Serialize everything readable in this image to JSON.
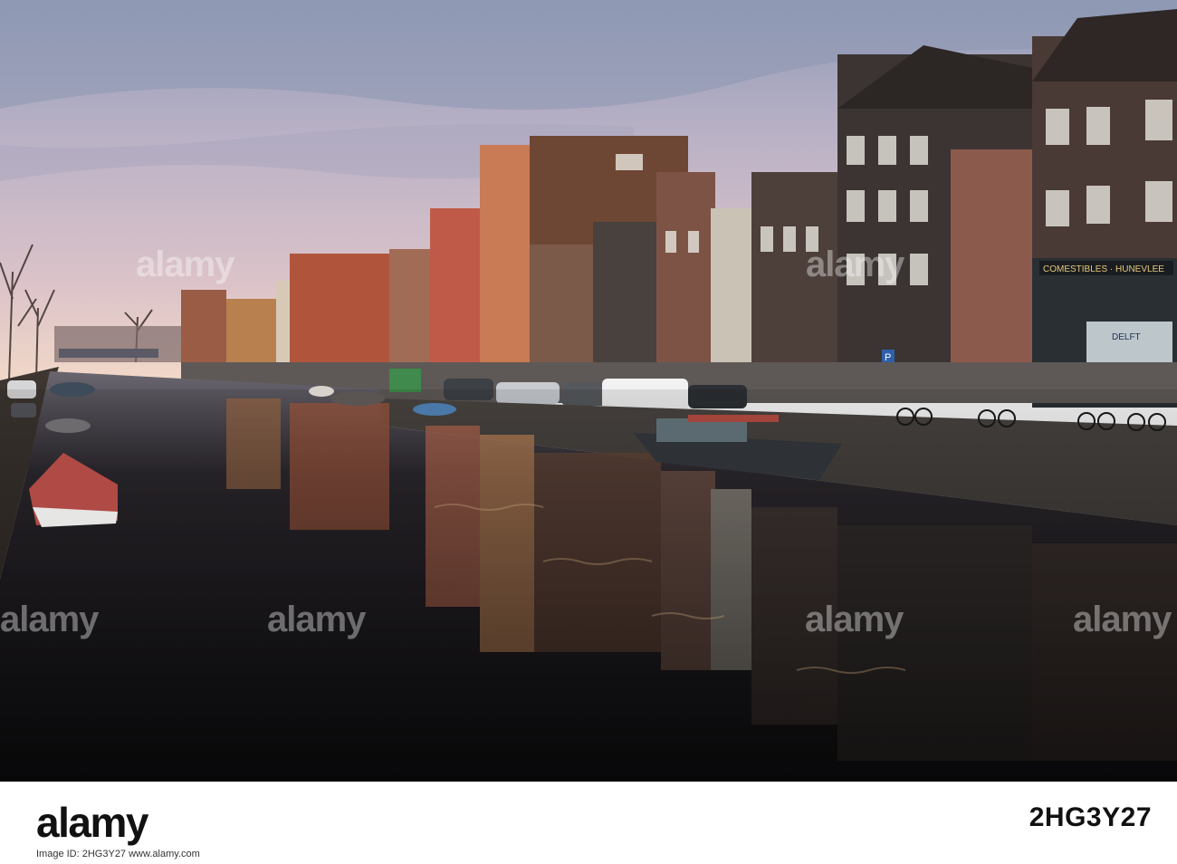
{
  "photo": {
    "scene": "Amsterdam canal",
    "colors": {
      "sky_top": "#9aa3bd",
      "sky_mid": "#c9b9c9",
      "sky_horizon": "#f2d6c6",
      "water": "#1d1b1f",
      "brick": "#8f4c36",
      "dark_house": "#3b3432"
    },
    "signs": {
      "shop_sign": "COMESTIBLES · HUNEVLEE",
      "delft_sign": "DELFT",
      "parking_sign": "P"
    }
  },
  "watermark": {
    "text": "alamy"
  },
  "footer": {
    "brand": "alamy",
    "image_id": "2HG3Y27",
    "meta": "Image ID: 2HG3Y27  www.alamy.com"
  }
}
